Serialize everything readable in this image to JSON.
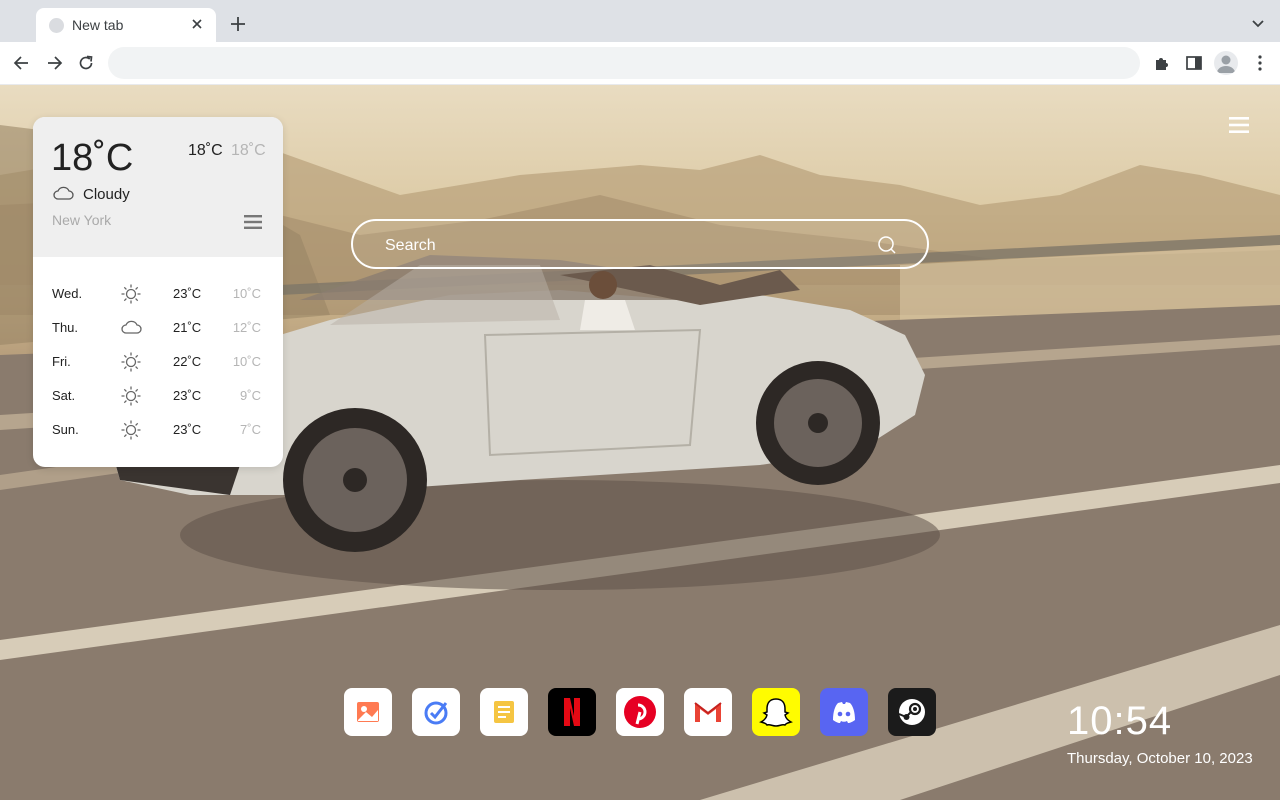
{
  "browser": {
    "tab_title": "New tab",
    "omnibox_value": "",
    "omnibox_placeholder": ""
  },
  "weather": {
    "current_temp": "18˚C",
    "high": "18˚C",
    "low": "18˚C",
    "condition": "Cloudy",
    "condition_icon": "cloud-icon",
    "city": "New York",
    "forecast": [
      {
        "day": "Wed.",
        "icon": "sun-icon",
        "high": "23˚C",
        "low": "10˚C"
      },
      {
        "day": "Thu.",
        "icon": "cloud-icon",
        "high": "21˚C",
        "low": "12˚C"
      },
      {
        "day": "Fri.",
        "icon": "sun-icon",
        "high": "22˚C",
        "low": "10˚C"
      },
      {
        "day": "Sat.",
        "icon": "sun-icon",
        "high": "23˚C",
        "low": "9˚C"
      },
      {
        "day": "Sun.",
        "icon": "sun-icon",
        "high": "23˚C",
        "low": "7˚C"
      }
    ]
  },
  "search": {
    "placeholder": "Search"
  },
  "dock": {
    "apps": [
      "wallpaper-app-icon",
      "checkmark-app-icon",
      "notes-app-icon",
      "netflix-icon",
      "pinterest-icon",
      "gmail-icon",
      "snapchat-icon",
      "discord-icon",
      "steam-icon"
    ]
  },
  "clock": {
    "time": "10:54",
    "date": "Thursday, October 10, 2023"
  },
  "colors": {
    "netflix": "#000000",
    "netflix_red": "#e50914",
    "pinterest": "#e60023",
    "snapchat": "#fffc00",
    "discord": "#5865f2",
    "steam": "#1b1b1b"
  }
}
